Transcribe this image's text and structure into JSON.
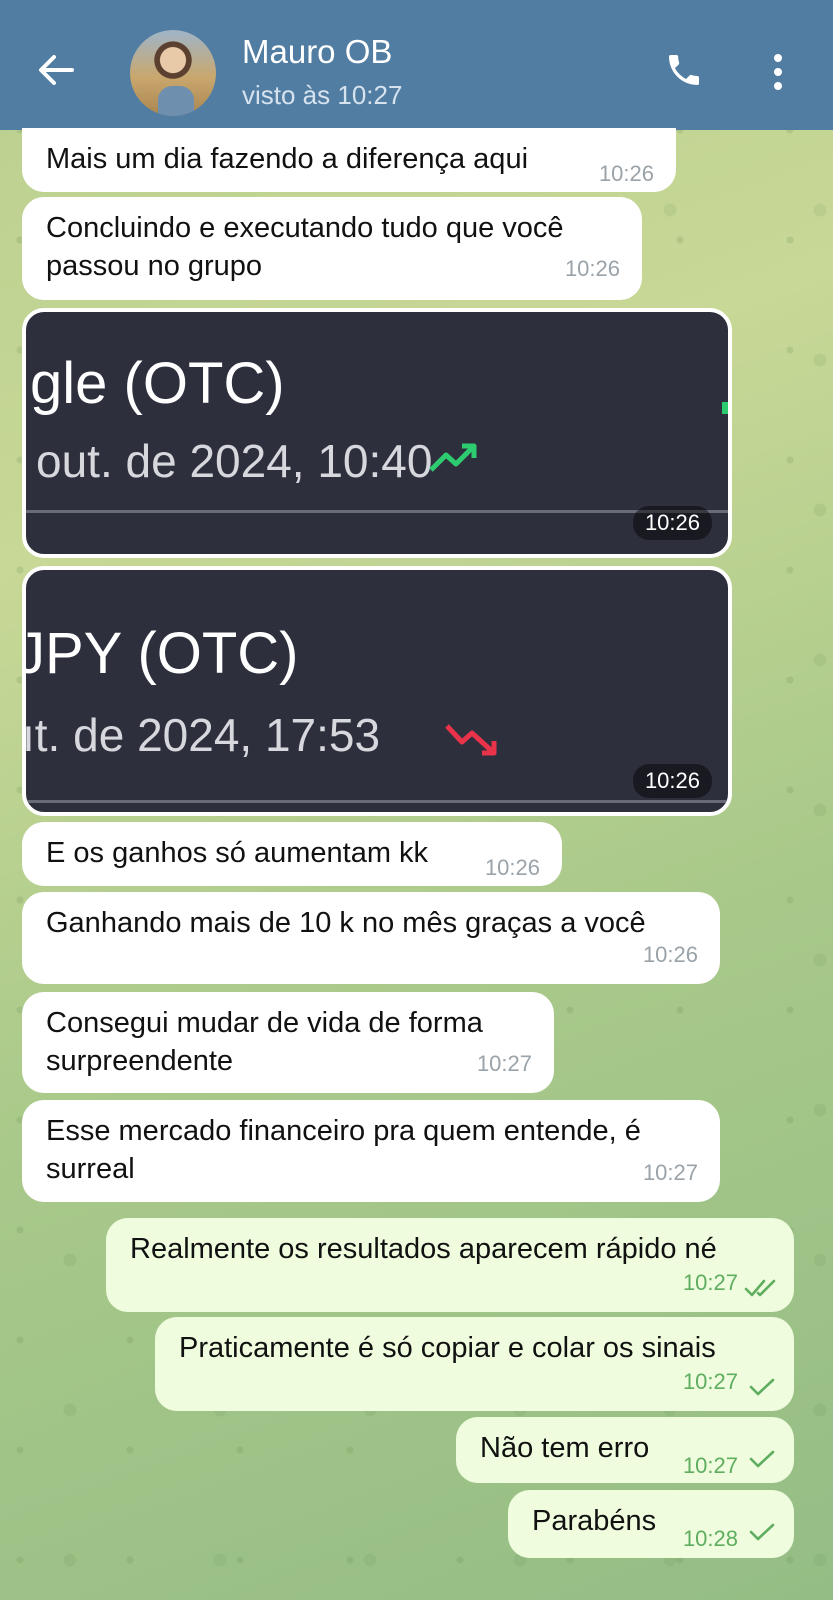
{
  "header": {
    "title": "Mauro OB",
    "status": "visto às 10:27"
  },
  "messages": [
    {
      "text": "Mais um dia fazendo a diferença aqui",
      "time": "10:26"
    },
    {
      "text": "Concluindo e executando tudo que você passou no grupo",
      "line1": "Concluindo e executando tudo que você",
      "line2": "passou no grupo",
      "time": "10:26"
    },
    {
      "image": true,
      "line1": "gle (OTC)",
      "line2": "out. de 2024, 10:40",
      "trend": "up",
      "time": "10:26"
    },
    {
      "image": true,
      "line1": "JPY (OTC)",
      "line2": "ıt. de 2024, 17:53",
      "trend": "down",
      "time": "10:26"
    },
    {
      "text": "E os ganhos só aumentam kk",
      "time": "10:26"
    },
    {
      "text": "Ganhando mais de 10 k no mês graças a você",
      "time": "10:26"
    },
    {
      "text": "Consegui mudar de vida de forma surpreendente",
      "line1": "Consegui mudar de vida de forma",
      "line2": "surpreendente",
      "time": "10:27"
    },
    {
      "text": "Esse mercado financeiro pra quem entende, é surreal",
      "line1": "Esse mercado financeiro pra quem entende, é",
      "line2": "surreal",
      "time": "10:27"
    },
    {
      "text": "Realmente os resultados aparecem rápido né",
      "time": "10:27",
      "outgoing": true,
      "status": "read"
    },
    {
      "text": "Praticamente é só copiar e colar os sinais",
      "time": "10:27",
      "outgoing": true,
      "status": "sent"
    },
    {
      "text": "Não tem erro",
      "time": "10:27",
      "outgoing": true,
      "status": "sent"
    },
    {
      "text": "Parabéns",
      "time": "10:28",
      "outgoing": true,
      "status": "sent"
    }
  ],
  "colors": {
    "header": "#517da2",
    "incoming_bubble": "#ffffff",
    "outgoing_bubble": "#effdde",
    "check_green": "#5fad5f",
    "trend_up": "#2ecc71",
    "trend_down": "#e8334a"
  },
  "icons": [
    "back-arrow-icon",
    "phone-icon",
    "more-vertical-icon",
    "double-check-icon",
    "check-icon",
    "trend-up-icon",
    "trend-down-icon"
  ]
}
